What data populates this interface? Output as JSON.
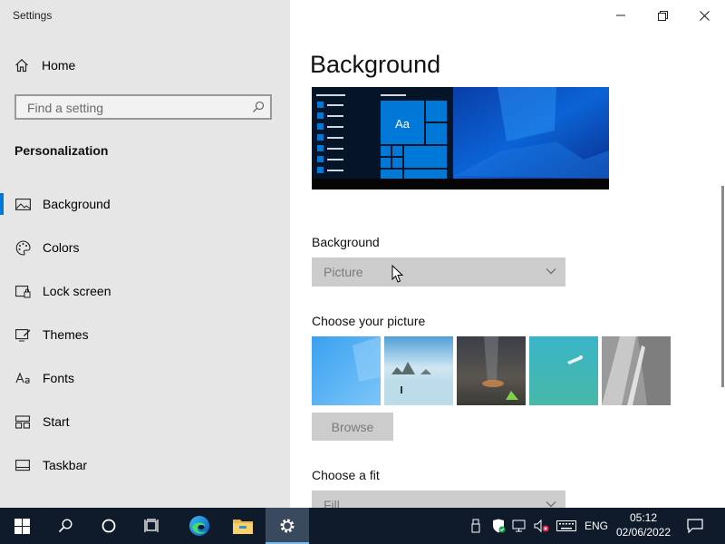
{
  "window": {
    "title": "Settings",
    "controls": [
      "minimize",
      "maximize",
      "close"
    ]
  },
  "sidebar": {
    "home_label": "Home",
    "search_placeholder": "Find a setting",
    "section_title": "Personalization",
    "items": [
      {
        "label": "Background",
        "icon": "picture-icon",
        "active": true
      },
      {
        "label": "Colors",
        "icon": "palette-icon"
      },
      {
        "label": "Lock screen",
        "icon": "lock-screen-icon"
      },
      {
        "label": "Themes",
        "icon": "themes-icon"
      },
      {
        "label": "Fonts",
        "icon": "fonts-icon"
      },
      {
        "label": "Start",
        "icon": "start-icon"
      },
      {
        "label": "Taskbar",
        "icon": "taskbar-icon"
      }
    ]
  },
  "main": {
    "page_title": "Background",
    "preview": {
      "tile_text": "Aa"
    },
    "background_label": "Background",
    "background_value": "Picture",
    "choose_picture_label": "Choose your picture",
    "pictures": [
      "windows-blue",
      "beach-rocks",
      "night-sky-tent",
      "underwater-swimmer",
      "rock-cliff"
    ],
    "browse_label": "Browse",
    "choose_fit_label": "Choose a fit",
    "fit_value": "Fill"
  },
  "taskbar": {
    "buttons": [
      "start-icon",
      "search-icon",
      "cortana-icon",
      "task-view-icon",
      "edge-icon",
      "file-explorer-icon",
      "settings-icon"
    ],
    "active": "settings-icon",
    "language": "ENG",
    "time": "05:12",
    "date": "02/06/2022"
  },
  "colors": {
    "accent": "#0078d7",
    "sidebar_bg": "#e6e6e6",
    "taskbar_bg": "#0f1b2b"
  }
}
